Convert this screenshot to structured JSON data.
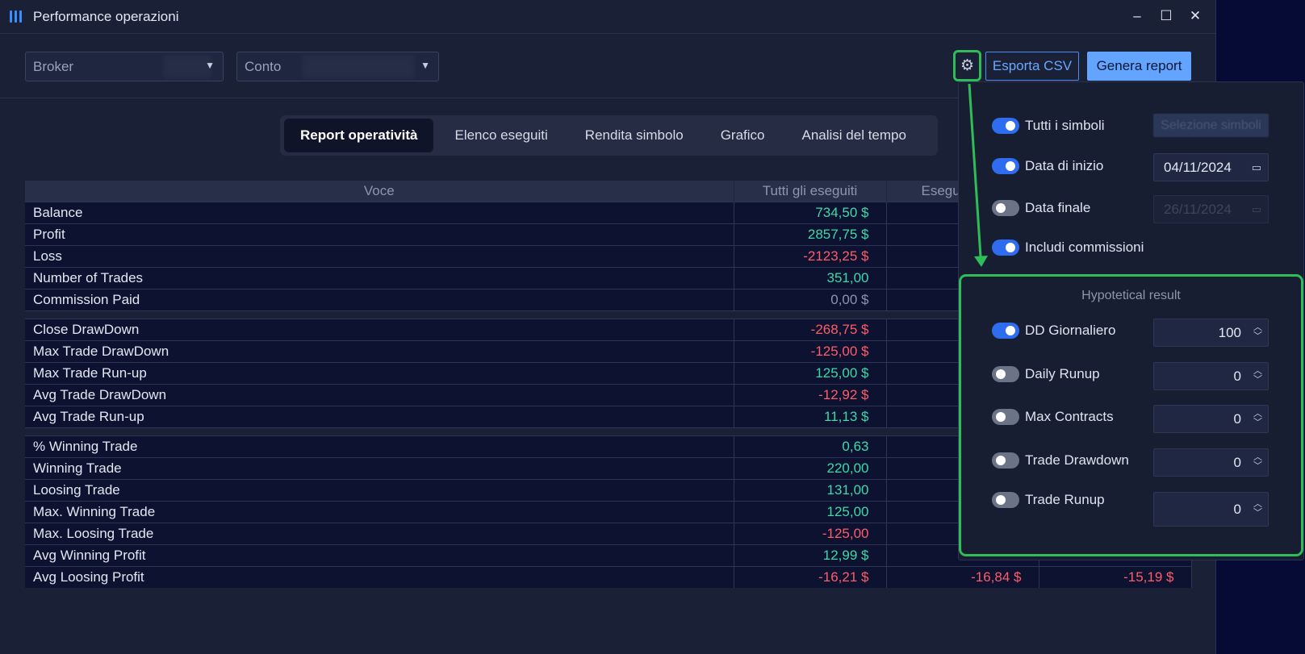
{
  "window": {
    "title": "Performance operazioni",
    "controls": [
      "minimize-icon",
      "maximize-icon",
      "close-icon"
    ]
  },
  "toolbar": {
    "broker_label": "Broker",
    "conto_label": "Conto",
    "export_label": "Esporta CSV",
    "generate_label": "Genera report"
  },
  "tabs": [
    {
      "label": "Report operatività",
      "active": true
    },
    {
      "label": "Elenco eseguiti",
      "active": false
    },
    {
      "label": "Rendita simbolo",
      "active": false
    },
    {
      "label": "Grafico",
      "active": false
    },
    {
      "label": "Analisi del tempo",
      "active": false
    }
  ],
  "table": {
    "headers": [
      "Voce",
      "Tutti gli eseguiti",
      "Esegu",
      ""
    ],
    "rows": [
      {
        "label": "Balance",
        "v1": "734,50 $",
        "v1c": "pos",
        "v2": "",
        "v3": ""
      },
      {
        "label": "Profit",
        "v1": "2857,75 $",
        "v1c": "pos",
        "v2": "",
        "v3": ""
      },
      {
        "label": "Loss",
        "v1": "-2123,25 $",
        "v1c": "neg",
        "v2": "",
        "v3": ""
      },
      {
        "label": "Number of Trades",
        "v1": "351,00",
        "v1c": "pos",
        "v2": "",
        "v3": ""
      },
      {
        "label": "Commission Paid",
        "v1": "0,00 $",
        "v1c": "neu",
        "v2": "",
        "v3": ""
      },
      {
        "gap": true
      },
      {
        "label": "Close DrawDown",
        "v1": "-268,75 $",
        "v1c": "neg",
        "v2": "",
        "v3": ""
      },
      {
        "label": "Max Trade DrawDown",
        "v1": "-125,00 $",
        "v1c": "neg",
        "v2": "",
        "v3": ""
      },
      {
        "label": "Max Trade Run-up",
        "v1": "125,00 $",
        "v1c": "pos",
        "v2": "",
        "v3": ""
      },
      {
        "label": "Avg Trade DrawDown",
        "v1": "-12,92 $",
        "v1c": "neg",
        "v2": "",
        "v3": ""
      },
      {
        "label": "Avg Trade Run-up",
        "v1": "11,13 $",
        "v1c": "pos",
        "v2": "",
        "v3": ""
      },
      {
        "gap": true
      },
      {
        "label": "% Winning Trade",
        "v1": "0,63",
        "v1c": "pos",
        "v2": "",
        "v3": ""
      },
      {
        "label": "Winning Trade",
        "v1": "220,00",
        "v1c": "pos",
        "v2": "",
        "v3": ""
      },
      {
        "label": "Loosing Trade",
        "v1": "131,00",
        "v1c": "pos",
        "v2": "",
        "v3": ""
      },
      {
        "label": "Max. Winning Trade",
        "v1": "125,00",
        "v1c": "pos",
        "v2": "",
        "v3": ""
      },
      {
        "label": "Max. Loosing Trade",
        "v1": "-125,00",
        "v1c": "neg",
        "v2": "",
        "v3": ""
      },
      {
        "label": "Avg Winning Profit",
        "v1": "12,99 $",
        "v1c": "pos",
        "v2": "",
        "v3": ""
      },
      {
        "label": "Avg Loosing Profit",
        "v1": "-16,21 $",
        "v1c": "neg",
        "v2": "-16,84 $",
        "v3": "-15,19 $"
      }
    ]
  },
  "settings": {
    "all_symbols": {
      "label": "Tutti i simboli",
      "on": true,
      "button": "Selezione simboli"
    },
    "start_date": {
      "label": "Data di inizio",
      "on": true,
      "value": "04/11/2024"
    },
    "end_date": {
      "label": "Data finale",
      "on": false,
      "value": "26/11/2024"
    },
    "commissions": {
      "label": "Includi commissioni",
      "on": true
    },
    "hypothetical": {
      "title": "Hypotetical result",
      "items": [
        {
          "label": "DD Giornaliero",
          "on": true,
          "value": "100"
        },
        {
          "label": "Daily Runup",
          "on": false,
          "value": "0"
        },
        {
          "label": "Max Contracts",
          "on": false,
          "value": "0"
        },
        {
          "label": "Trade Drawdown",
          "on": false,
          "value": "0"
        },
        {
          "label": "Trade Runup",
          "on": false,
          "value": "0"
        }
      ]
    }
  },
  "colors": {
    "accent": "#3a8dff",
    "positive": "#3ed9a8",
    "negative": "#ff5c6a",
    "highlight": "#2fbd58"
  }
}
